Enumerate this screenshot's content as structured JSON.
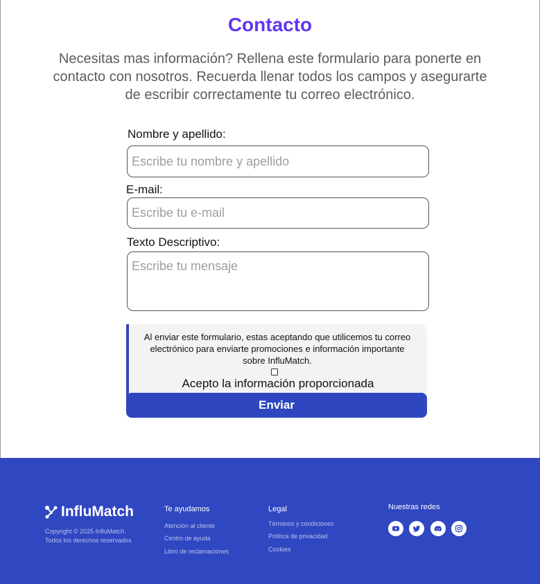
{
  "header": {
    "title": "Contacto",
    "intro": "Necesitas mas información? Rellena este formulario para ponerte en contacto con nosotros. Recuerda llenar todos los campos y asegurarte de escribir correctamente tu correo electrónico."
  },
  "form": {
    "name_label": "Nombre y apellido:",
    "name_placeholder": "Escribe tu nombre y apellido",
    "name_value": "",
    "email_label": "E-mail:",
    "email_placeholder": "Escribe tu e-mail",
    "email_value": "",
    "message_label": "Texto Descriptivo:",
    "message_placeholder": "Escribe tu mensaje",
    "message_value": "",
    "consent_text": "Al enviar este formulario, estas aceptando que utilicemos tu correo electrónico para enviarte promociones e información importante sobre InfluMatch.",
    "consent_label": "Acepto la información proporcionada",
    "consent_checked": false,
    "submit_label": "Enviar"
  },
  "footer": {
    "brand": "InfluMatch",
    "copyright_line1": "Copyright © 2025 InfluMatch.",
    "copyright_line2": "Todos los derechos reservados",
    "help": {
      "title": "Te ayudamos",
      "links": [
        "Atencion al cliente",
        "Centro de ayuda",
        "Libro de reclamaciones"
      ]
    },
    "legal": {
      "title": "Legal",
      "links": [
        "Términos y condiciones",
        "Política de privacidad",
        "Cookies"
      ]
    },
    "social": {
      "title": "Nuestras redes",
      "icons": [
        "youtube-icon",
        "twitter-icon",
        "discord-icon",
        "instagram-icon"
      ]
    }
  },
  "colors": {
    "accent_title": "#6236f0",
    "brand_blue": "#2f47c0",
    "submit_blue": "#2e47c0"
  }
}
